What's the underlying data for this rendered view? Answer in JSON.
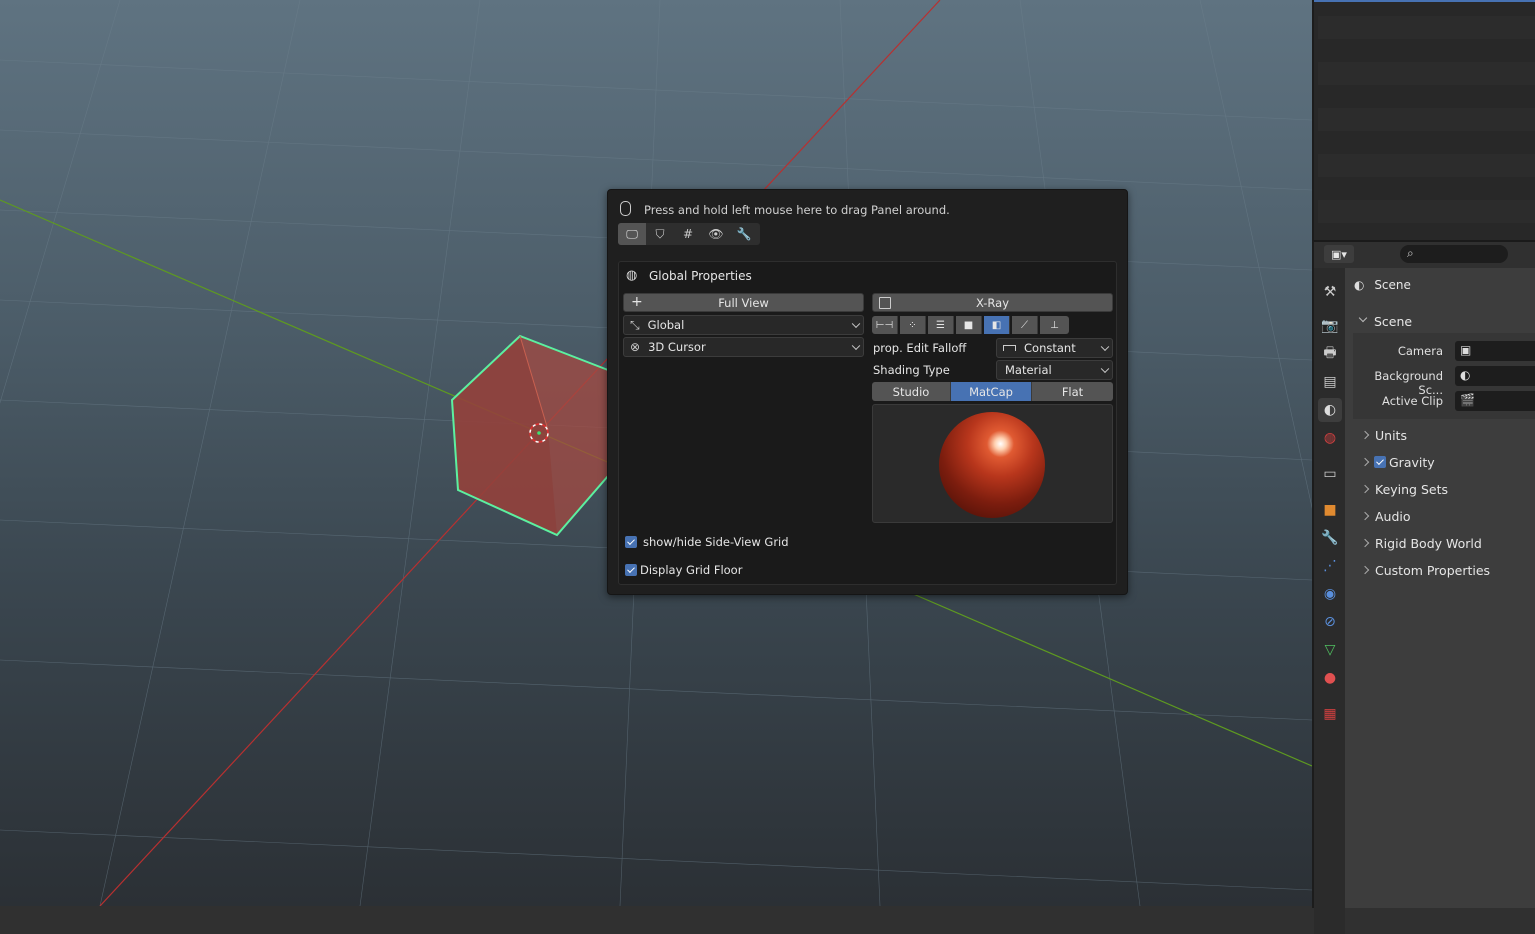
{
  "panel": {
    "hint": "Press and hold left mouse here to drag Panel around.",
    "tabs": [
      "display-icon",
      "object-icon",
      "grid-icon",
      "visibility-icon",
      "wrench-icon"
    ],
    "section_title": "Global Properties",
    "full_view": "Full View",
    "xray": "X-Ray",
    "orientation": "Global",
    "pivot": "3D Cursor",
    "prop_edit_label": "prop. Edit Falloff",
    "prop_edit_value": "Constant",
    "shading_type_label": "Shading Type",
    "shading_type_value": "Material",
    "shading_modes": [
      "Studio",
      "MatCap",
      "Flat"
    ],
    "shading_active": "MatCap",
    "checkboxes": [
      {
        "label": "show/hide Side-View Grid",
        "checked": true
      },
      {
        "label": "Display Grid Floor",
        "checked": true
      }
    ]
  },
  "properties": {
    "breadcrumb": "Scene",
    "section": "Scene",
    "fields": [
      {
        "label": "Camera",
        "icon": "camera-icon"
      },
      {
        "label": "Background Sc...",
        "icon": "scene-icon"
      },
      {
        "label": "Active Clip",
        "icon": "clip-icon"
      }
    ],
    "collapsed_sections": [
      "Units",
      "Gravity",
      "Keying Sets",
      "Audio",
      "Rigid Body World",
      "Custom Properties"
    ],
    "gravity_checked": true
  },
  "colors": {
    "accent": "#4772b3",
    "selection_outline": "#5cf0a0",
    "cube": "#b8483c",
    "x_axis": "#c03030",
    "y_axis": "#6aa020"
  }
}
